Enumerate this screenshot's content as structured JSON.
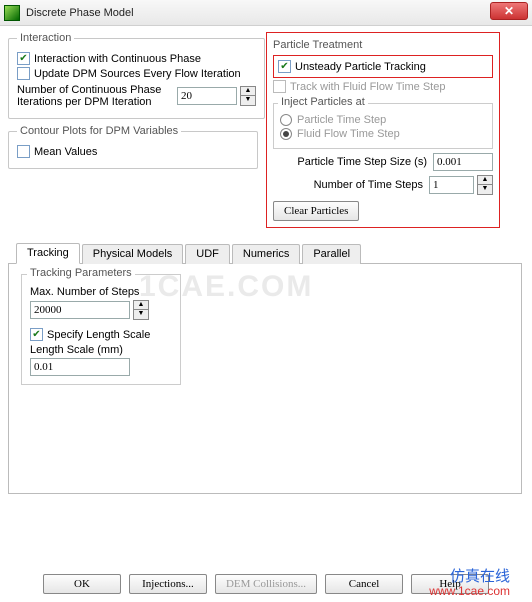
{
  "title": "Discrete Phase Model",
  "interaction": {
    "legend": "Interaction",
    "interact_label": "Interaction with Continuous Phase",
    "update_label": "Update DPM Sources Every Flow Iteration",
    "num_iter_label": "Number of Continuous Phase Iterations per DPM Iteration",
    "num_iter_value": "20"
  },
  "contour": {
    "legend": "Contour Plots for DPM Variables",
    "mean_label": "Mean Values"
  },
  "particle": {
    "legend": "Particle Treatment",
    "unsteady_label": "Unsteady Particle Tracking",
    "track_ff_label": "Track with Fluid Flow Time Step",
    "inject_legend": "Inject Particles at",
    "opt_pts": "Particle Time Step",
    "opt_ffts": "Fluid Flow Time Step",
    "pts_size_label": "Particle Time Step Size (s)",
    "pts_size_value": "0.001",
    "num_steps_label": "Number of Time Steps",
    "num_steps_value": "1",
    "clear_btn": "Clear Particles"
  },
  "tabs": {
    "t0": "Tracking",
    "t1": "Physical Models",
    "t2": "UDF",
    "t3": "Numerics",
    "t4": "Parallel"
  },
  "tracking": {
    "legend": "Tracking Parameters",
    "max_steps_label": "Max. Number of Steps",
    "max_steps_value": "20000",
    "spec_len_label": "Specify Length Scale",
    "len_label": "Length Scale (mm)",
    "len_value": "0.01"
  },
  "watermark_big": "1CAE.COM",
  "site_cn": "仿真在线",
  "site_url": "www.1cae.com",
  "buttons": {
    "ok": "OK",
    "inj": "Injections...",
    "dem": "DEM Collisions...",
    "cancel": "Cancel",
    "help": "Help"
  }
}
